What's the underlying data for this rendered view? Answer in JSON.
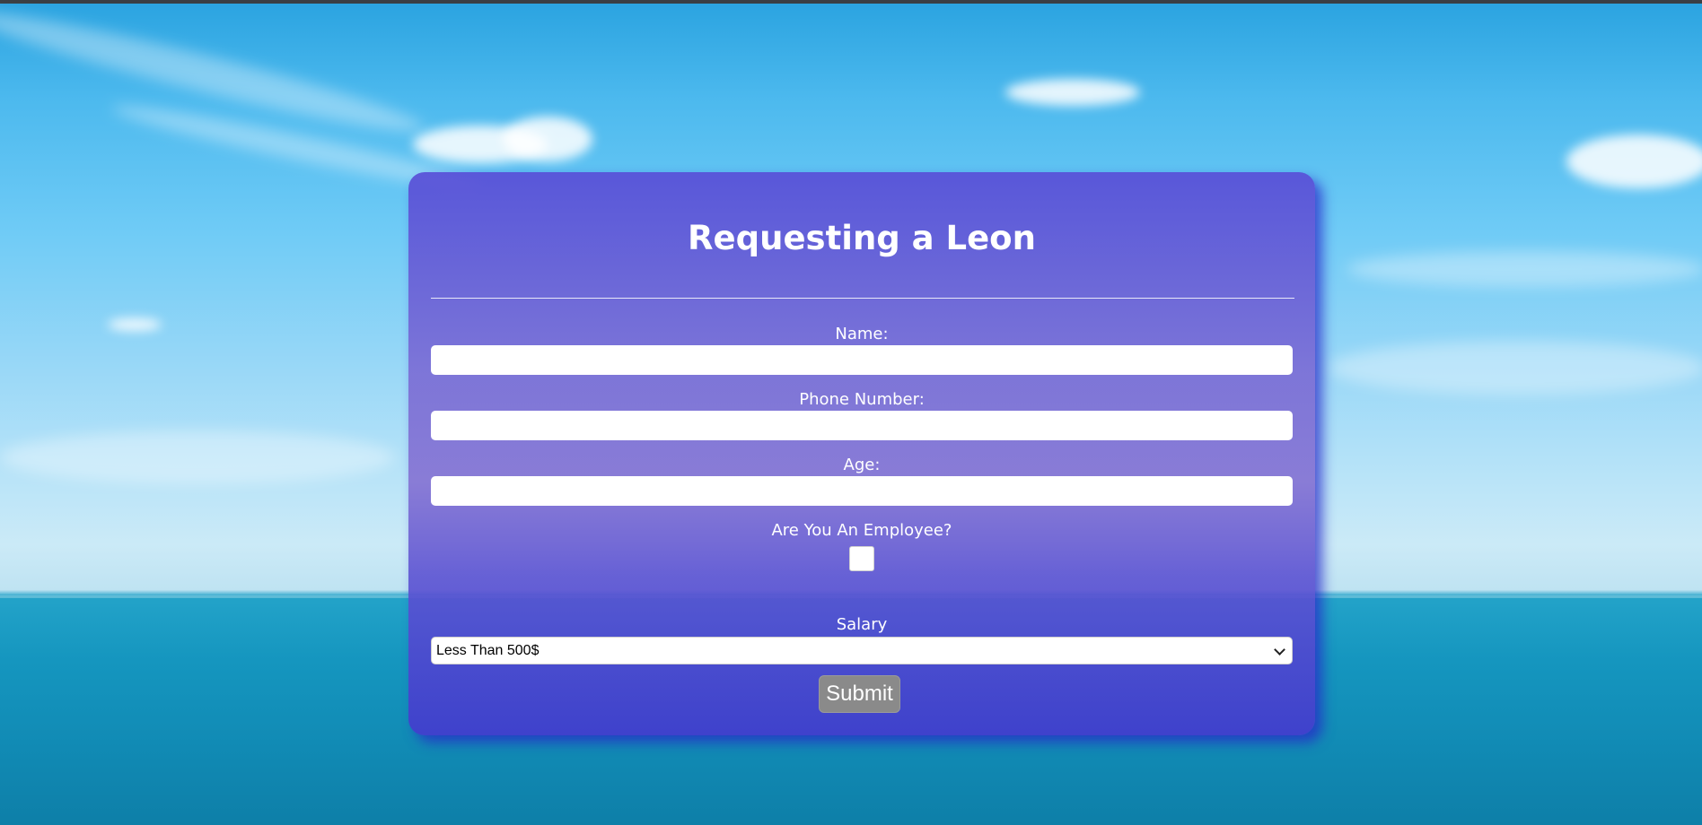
{
  "form": {
    "title": "Requesting a Leon",
    "fields": [
      {
        "label": "Name:",
        "value": ""
      },
      {
        "label": "Phone Number:",
        "value": ""
      },
      {
        "label": "Age:",
        "value": ""
      }
    ],
    "employee": {
      "label": "Are You An Employee?",
      "checked": false
    },
    "salary": {
      "label": "Salary",
      "selected": "Less Than 500$"
    },
    "submit_label": "Submit"
  },
  "colors": {
    "card": "#6a5fd6",
    "submit": "#8a8a8a",
    "text": "#ffffff"
  }
}
